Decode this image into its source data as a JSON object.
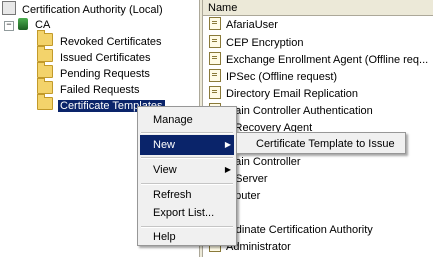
{
  "tree": {
    "root_label": "Certification Authority (Local)",
    "ca_label": "CA",
    "ca_expander": "−",
    "folders": [
      {
        "label": "Revoked Certificates"
      },
      {
        "label": "Issued Certificates"
      },
      {
        "label": "Pending Requests"
      },
      {
        "label": "Failed Requests"
      },
      {
        "label": "Certificate Templates",
        "selected": true
      }
    ]
  },
  "list": {
    "header": "Name",
    "items": [
      "AfariaUser",
      "CEP Encryption",
      "Exchange Enrollment Agent (Offline req...",
      "IPSec (Offline request)",
      "Directory Email Replication",
      "main Controller Authentication",
      "s Recovery Agent",
      "",
      "main Controller",
      "b Server",
      "mputer",
      "er",
      "ordinate Certification Authority",
      "Administrator"
    ]
  },
  "context_menu": {
    "items": {
      "manage": "Manage",
      "new": "New",
      "view": "View",
      "refresh": "Refresh",
      "export_list": "Export List...",
      "help": "Help"
    },
    "submenu_arrow": "▶",
    "new_submenu": {
      "certificate_template_to_issue": "Certificate Template to Issue"
    }
  },
  "colors": {
    "selection": "#0a246a",
    "menu_bg": "#f0f0f0",
    "header_bg": "#ece9d8"
  }
}
